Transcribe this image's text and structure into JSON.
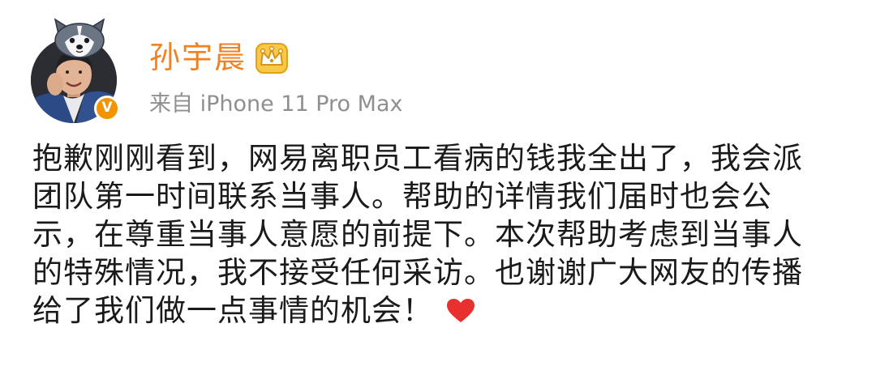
{
  "post": {
    "author": {
      "name": "孙宇晨",
      "source": "来自 iPhone 11 Pro Max",
      "verified_mark": "V",
      "badge_icon": "crown-icon",
      "avatar_pendant_icon": "husky-pendant-icon"
    },
    "content_lines": [
      "抱歉刚刚看到，网易离职员工看病的钱我全出了，我会派",
      "团队第一时间联系当事人。帮助的详情我们届时也会公",
      "示，在尊重当事人意愿的前提下。本次帮助考虑到当事人",
      "的特殊情况，我不接受任何采访。也谢谢广大网友的传播",
      "给了我们做一点事情的机会！"
    ],
    "trailing_icon": "red-heart-icon"
  },
  "colors": {
    "username": "#f08224",
    "source": "#8f8f8f",
    "body_text": "#1a1a1a",
    "verified": "#f29300",
    "heart": "#e8312f",
    "crown": "#f4b400"
  }
}
